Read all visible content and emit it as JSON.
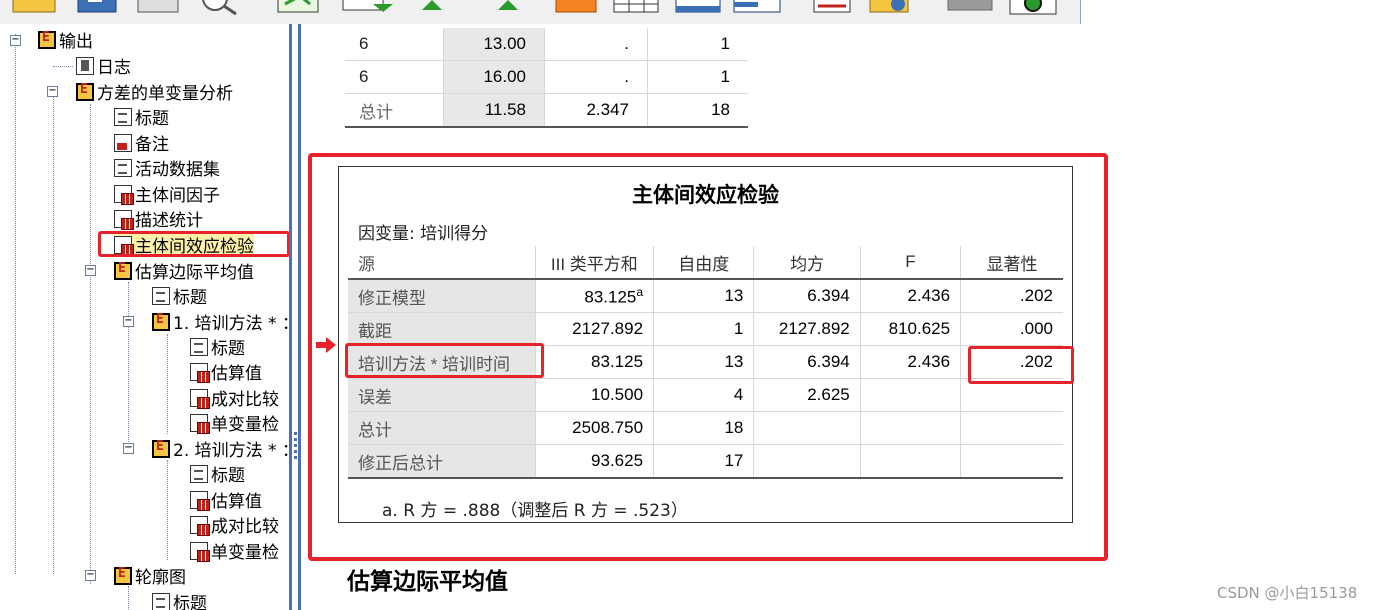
{
  "nav": {
    "items": [
      {
        "label": "输出"
      },
      {
        "label": "日志"
      },
      {
        "label": "方差的单变量分析"
      },
      {
        "label": "标题"
      },
      {
        "label": "备注"
      },
      {
        "label": "活动数据集"
      },
      {
        "label": "主体间因子"
      },
      {
        "label": "描述统计"
      },
      {
        "label": "主体间效应检验"
      },
      {
        "label": "估算边际平均值"
      },
      {
        "label": "标题"
      },
      {
        "label": "1. 培训方法 * ："
      },
      {
        "label": "标题"
      },
      {
        "label": "估算值"
      },
      {
        "label": "成对比较"
      },
      {
        "label": "单变量检"
      },
      {
        "label": "2. 培训方法 * ："
      },
      {
        "label": "标题"
      },
      {
        "label": "估算值"
      },
      {
        "label": "成对比较"
      },
      {
        "label": "单变量检"
      },
      {
        "label": "轮廓图"
      },
      {
        "label": "标题"
      }
    ]
  },
  "top_table": {
    "rows": [
      {
        "label": "6",
        "mean": "13.00",
        "sd": ".",
        "n": "1"
      },
      {
        "label": "6",
        "mean": "16.00",
        "sd": ".",
        "n": "1"
      },
      {
        "label": "总计",
        "mean": "11.58",
        "sd": "2.347",
        "n": "18"
      }
    ]
  },
  "anova": {
    "title": "主体间效应检验",
    "dependent_var": "因变量:   培训得分",
    "headers": {
      "source": "源",
      "ss": "III 类平方和",
      "df": "自由度",
      "ms": "均方",
      "f": "F",
      "sig": "显著性"
    },
    "rows": [
      {
        "source": "修正模型",
        "ss": "83.125",
        "ss_sup": "a",
        "df": "13",
        "ms": "6.394",
        "f": "2.436",
        "sig": ".202"
      },
      {
        "source": "截距",
        "ss": "2127.892",
        "ss_sup": "",
        "df": "1",
        "ms": "2127.892",
        "f": "810.625",
        "sig": ".000"
      },
      {
        "source": "培训方法 * 培训时间",
        "ss": "83.125",
        "ss_sup": "",
        "df": "13",
        "ms": "6.394",
        "f": "2.436",
        "sig": ".202"
      },
      {
        "source": "误差",
        "ss": "10.500",
        "ss_sup": "",
        "df": "4",
        "ms": "2.625",
        "f": "",
        "sig": ""
      },
      {
        "source": "总计",
        "ss": "2508.750",
        "ss_sup": "",
        "df": "18",
        "ms": "",
        "f": "",
        "sig": ""
      },
      {
        "source": "修正后总计",
        "ss": "93.625",
        "ss_sup": "",
        "df": "17",
        "ms": "",
        "f": "",
        "sig": ""
      }
    ],
    "footnote": "a. R 方 = .888（调整后 R 方 = .523）"
  },
  "section_title": "估算边际平均值",
  "watermark": "CSDN @小白15138",
  "colors": {
    "highlight": "#e8222a",
    "splitter": "#4d6fb5"
  }
}
